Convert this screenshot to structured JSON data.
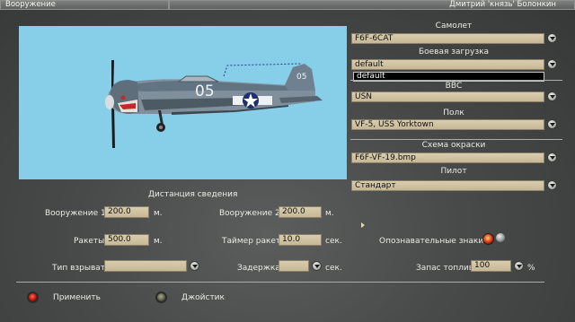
{
  "titlebar": {
    "left": "Вооружение",
    "right": "Дмитрий 'князь' Болонкин"
  },
  "right_panel": {
    "aircraft_label": "Самолет",
    "aircraft_value": "F6F-6CAT",
    "loadout_label": "Боевая загрузка",
    "loadout_value": "default",
    "loadout_dropdown_option": "default",
    "airforce_label": "ВВС",
    "airforce_value": "USN",
    "regiment_label": "Полк",
    "regiment_value": "VF-5, USS Yorktown",
    "skin_label": "Схема окраски",
    "skin_value": "F6F-VF-19.bmp",
    "pilot_label": "Пилот",
    "pilot_value": "Стандарт"
  },
  "preview": {
    "aircraft_number_fuselage": "05",
    "aircraft_number_tail": "05"
  },
  "convergence": {
    "title": "Дистанция сведения",
    "weapons1_label": "Вооружение 1:",
    "weapons1_value": "200.0",
    "weapons1_unit": "м.",
    "weapons2_label": "Вооружение 2:",
    "weapons2_value": "200.0",
    "weapons2_unit": "м.",
    "rockets_label": "Ракеты",
    "rockets_value": "500.0",
    "rockets_unit": "м.",
    "rocket_timer_label": "Таймер ракет:",
    "rocket_timer_value": "10.0",
    "rocket_timer_unit": "сек.",
    "markings_label": "Опознавательные знаки:",
    "fuze_label": "Тип взрыват.:",
    "fuze_value": "",
    "delay_label": "Задержка:",
    "delay_value": "",
    "delay_unit": "сек.",
    "fuel_label": "Запас топлива",
    "fuel_value": "100",
    "fuel_unit": "%"
  },
  "buttons": {
    "apply_label": "Применить",
    "joystick_label": "Джойстик"
  },
  "colors": {
    "preview_bg": "#87cee8",
    "field_bg": "#cdbf9d",
    "lamp_red": "#d42a1c"
  }
}
